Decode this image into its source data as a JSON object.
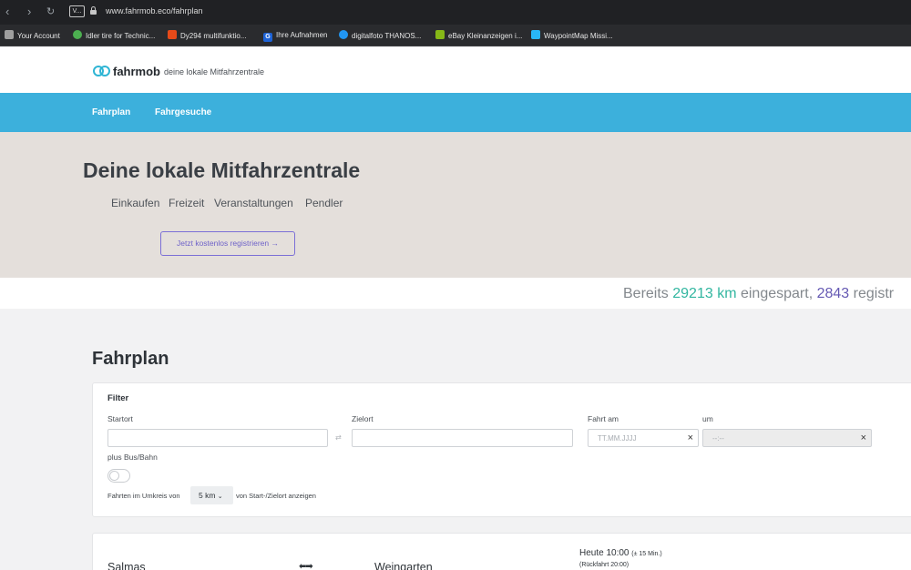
{
  "browser": {
    "extension_badge": "V...",
    "url": "www.fahrmob.eco/fahrplan",
    "bookmarks": [
      {
        "label": "Your Account",
        "icon": "trash-icon",
        "color": "#9e9e9e"
      },
      {
        "label": "Idler tire for Technic...",
        "icon": "tire-icon",
        "color": "#4caf50"
      },
      {
        "label": "Dy294 multifunktio...",
        "icon": "shop-icon",
        "color": "#e64a19"
      },
      {
        "label": "Ihre Aufnahmen",
        "icon": "google-icon",
        "color": "#1e63d6"
      },
      {
        "label": "digitalfoto THANOS...",
        "icon": "refresh-icon",
        "color": "#2196f3"
      },
      {
        "label": "eBay Kleinanzeigen i...",
        "icon": "tag-icon",
        "color": "#86b817"
      },
      {
        "label": "WaypointMap Missi...",
        "icon": "map-icon",
        "color": "#29b6f6"
      }
    ]
  },
  "site": {
    "brand": "fahrmob",
    "tagline": "deine lokale Mitfahrzentrale",
    "nav": [
      "Fahrplan",
      "Fahrgesuche"
    ],
    "hero": {
      "title": "Deine lokale Mitfahrzentrale",
      "categories": [
        "Einkaufen",
        "Freizeit",
        "Veranstaltungen",
        "Pendler"
      ],
      "cta": "Jetzt kostenlos registrieren →"
    },
    "stats": {
      "prefix": "Bereits",
      "km": "29213 km",
      "middle": "eingespart,",
      "users": "2843",
      "suffix": "registr"
    },
    "colors": {
      "primary": "#3cb0dc",
      "accent_teal": "#32b6a0",
      "accent_purple": "#6559b3"
    }
  },
  "main": {
    "title": "Fahrplan",
    "filter": {
      "heading": "Filter",
      "start_label": "Startort",
      "dest_label": "Zielort",
      "date_label": "Fahrt am",
      "date_placeholder": "TT.MM.JJJJ",
      "time_label": "um",
      "time_placeholder": "--:--",
      "bus_label": "plus Bus/Bahn",
      "bus_enabled": false,
      "radius_prefix": "Fahrten im Umkreis von",
      "radius_value": "5 km",
      "radius_suffix": "von Start-/Zielort anzeigen"
    },
    "rides": [
      {
        "from": "Salmas",
        "to": "Weingarten",
        "time": "Heute 10:00",
        "tolerance": "(± 15 Min.)",
        "return": "(Rückfahrt 20:00)"
      }
    ]
  }
}
